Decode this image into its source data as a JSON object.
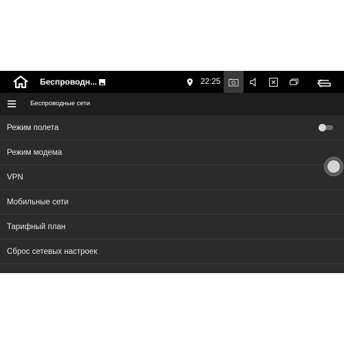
{
  "status_bar": {
    "app_title": "Беспроводн...",
    "time": "22:25",
    "icons": [
      "home-icon",
      "image-notification-icon",
      "location-icon",
      "camera-icon",
      "volume-icon",
      "close-box-icon",
      "window-icon",
      "back-arrow-icon"
    ]
  },
  "toolbar": {
    "title": "Беспроводные сети",
    "menu_icon": "hamburger-icon"
  },
  "settings": [
    {
      "label": "Режим полета",
      "has_toggle": true,
      "toggle_on": false
    },
    {
      "label": "Режим модема"
    },
    {
      "label": "VPN"
    },
    {
      "label": "Мобильные сети"
    },
    {
      "label": "Тарифный план"
    },
    {
      "label": "Сброс сетевых настроек"
    }
  ],
  "colors": {
    "status_bar_bg": "#000000",
    "toolbar_bg": "#1e1e1e",
    "content_bg": "#2b2b2b",
    "divider": "#3a3a3a",
    "text": "#e8e8e8"
  }
}
